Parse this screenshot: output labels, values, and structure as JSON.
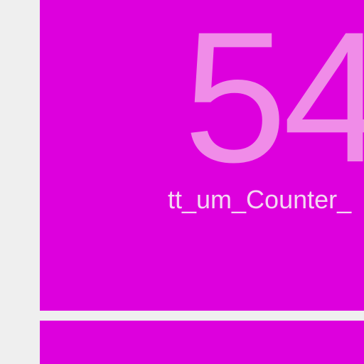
{
  "tile": {
    "color": "#dd00dd",
    "counter_value": "54",
    "counter_label": "tt_um_Counter_"
  },
  "colors": {
    "background": "#efefef",
    "value_text": "#f08ce8",
    "label_text": "#f4d8f2"
  }
}
